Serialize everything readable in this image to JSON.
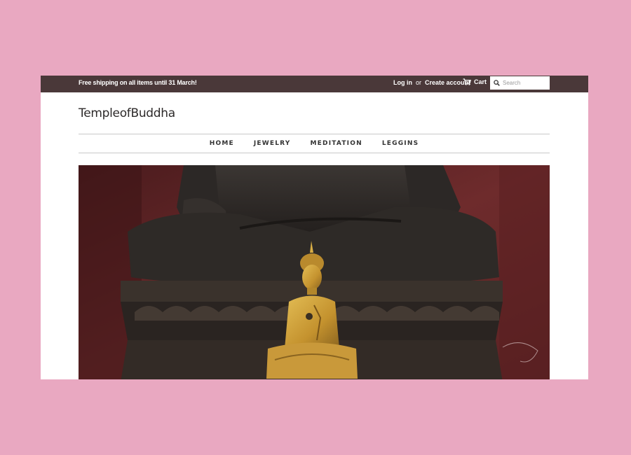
{
  "announcement": "Free shipping on all items until 31 March!",
  "account": {
    "login": "Log in",
    "or": "or",
    "create": "Create account"
  },
  "cart": {
    "label": "Cart",
    "icon": "cart-icon"
  },
  "search": {
    "placeholder": "Search",
    "icon": "search-icon"
  },
  "store_name": "TempleofBuddha",
  "nav": [
    "HOME",
    "JEWELRY",
    "MEDITATION",
    "LEGGINS"
  ],
  "colors": {
    "background": "#e9a8c1",
    "topbar": "#4a3839",
    "hero_wall": "#6b2a2a",
    "buddha_gold": "#c99a36"
  }
}
